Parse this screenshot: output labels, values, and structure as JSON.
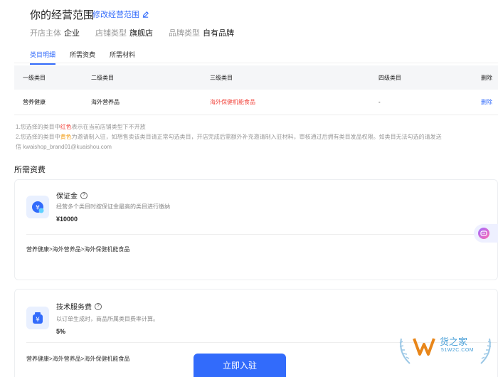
{
  "header": {
    "title": "你的经营范围",
    "edit_label": "修改经营范围"
  },
  "meta": [
    {
      "label": "开店主体",
      "value": "企业"
    },
    {
      "label": "店铺类型",
      "value": "旗舰店"
    },
    {
      "label": "品牌类型",
      "value": "自有品牌"
    }
  ],
  "tabs": [
    {
      "label": "类目明细",
      "active": true
    },
    {
      "label": "所需资费",
      "active": false
    },
    {
      "label": "所需材料",
      "active": false
    }
  ],
  "table": {
    "headers": [
      "一级类目",
      "二级类目",
      "三级类目",
      "四级类目",
      "删除"
    ],
    "rows": [
      {
        "l1": "营养健康",
        "l2": "海外营养品",
        "l3": "海外保健机能食品",
        "l4": "-",
        "action": "删除"
      }
    ]
  },
  "notes": {
    "line1_pre": "1.您选择的类目中",
    "line1_red": "红色",
    "line1_post": "表示在当前店铺类型下不开放",
    "line2_pre": "2.您选择的类目中",
    "line2_yellow": "黄色",
    "line2_post": "为邀请制入驻，如想售卖该类目请正常勾选类目，开店完成后需额外补充邀请制入驻材料，审核通过后拥有类目发品权限。如类目无法勾选的请发送",
    "line3": "信 kwaishop_brand01@kuaishou.com"
  },
  "fees_section_title": "所需资费",
  "fees": [
    {
      "name": "保证金",
      "desc": "经营多个类目时按保证金最高的类目进行缴纳",
      "amount": "¥10000",
      "path": "营养健康>海外营养品>海外保健机能食品",
      "icon_glyph": "¥"
    },
    {
      "name": "技术服务费",
      "desc": "以订单生成时，商品所属类目费率计算。",
      "amount": "5%",
      "path": "营养健康>海外营养品>海外保健机能食品",
      "icon_glyph": "¥"
    }
  ],
  "cta_label": "立即入驻",
  "watermark": {
    "text": "货之家",
    "sub": "51W2C.COM"
  },
  "colors": {
    "accent": "#326bfb",
    "red": "#f2473f",
    "yellow": "#f3a21f"
  }
}
